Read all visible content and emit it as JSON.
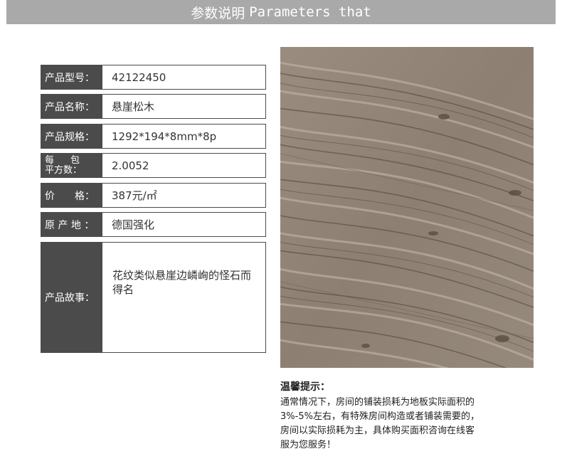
{
  "header": {
    "title_cn": "参数说明",
    "title_en": "Parameters that"
  },
  "params": {
    "model": {
      "label": "产品型号：",
      "value": "42122450"
    },
    "name": {
      "label": "产品名称：",
      "value": "悬崖松木"
    },
    "spec": {
      "label": "产品规格：",
      "value": "1292*194*8mm*8p"
    },
    "per_box": {
      "label_a": "每",
      "label_b": "包",
      "label_c": "平方数：",
      "value": "2.0052"
    },
    "price": {
      "label": "价　　格：",
      "value": "387元/㎡"
    },
    "origin": {
      "label": "原 产 地 ：",
      "value": "德国强化"
    },
    "story": {
      "label": "产品故事：",
      "value": "花纹类似悬崖边嶙峋的怪石而得名"
    }
  },
  "product_image": {
    "icon": "wood-texture-image",
    "colors": {
      "base": "#8d7f71",
      "light": "#b9ada0",
      "dark": "#5e5147"
    }
  },
  "tips": {
    "title": "温馨提示：",
    "line1": "通常情况下，房间的铺装损耗为地板实际面积的",
    "line2": "3%-5%左右，有特殊房间构造或者铺装需要的，",
    "line3": "房间以实际损耗为主，具体购买面积咨询在线客",
    "line4": "服为您服务！"
  }
}
